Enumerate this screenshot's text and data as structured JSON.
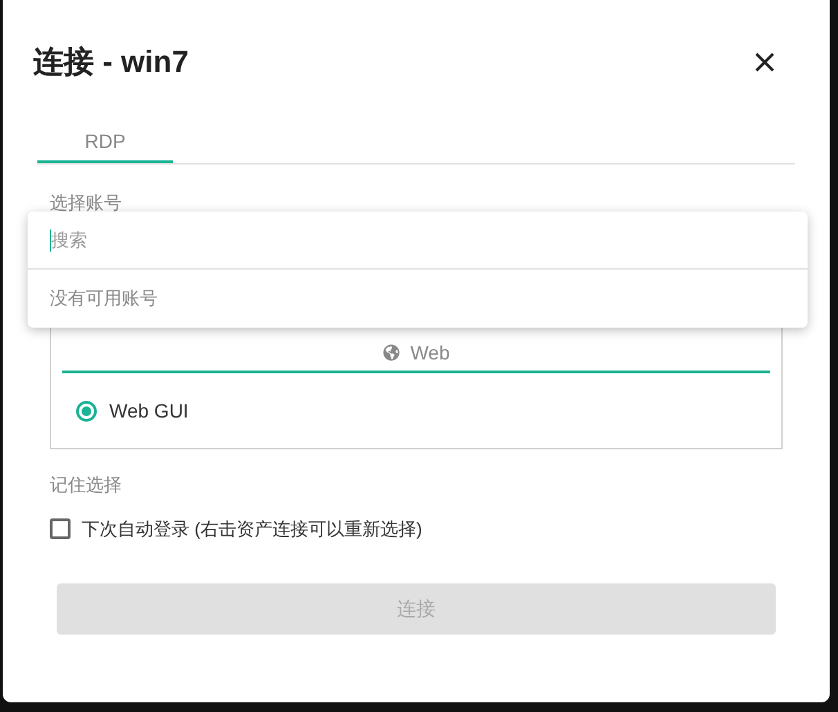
{
  "dialog": {
    "title": "连接 - win7"
  },
  "tabs": [
    {
      "label": "RDP",
      "selected": true
    }
  ],
  "account": {
    "label": "选择账号"
  },
  "dropdown": {
    "search": {
      "placeholder": "搜索"
    },
    "empty_text": "没有可用账号"
  },
  "connect_method": {
    "tabs": [
      {
        "label": "Web",
        "selected": true
      }
    ],
    "options": [
      {
        "label": "Web GUI",
        "selected": true
      }
    ]
  },
  "remember": {
    "label": "记住选择",
    "checkbox": {
      "label": "下次自动登录 (右击资产连接可以重新选择)",
      "checked": false
    }
  },
  "connect_button": {
    "label": "连接",
    "disabled": true
  }
}
